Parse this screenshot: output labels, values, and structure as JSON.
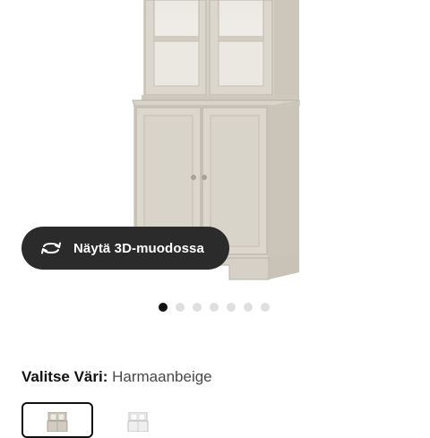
{
  "product": {
    "view_3d_label": "Näytä 3D-muodossa",
    "view_3d_icon": "rotate-3d-icon"
  },
  "carousel": {
    "total_images": 7,
    "active_index": 1
  },
  "color_selector": {
    "heading": "Valitse Väri:",
    "selected_value": "Harmaanbeige",
    "options": [
      {
        "name": "Harmaanbeige",
        "selected": true,
        "color": "#d6d0c4"
      },
      {
        "name": "Valkoinen",
        "selected": false,
        "color": "#f1f1f1"
      }
    ]
  }
}
